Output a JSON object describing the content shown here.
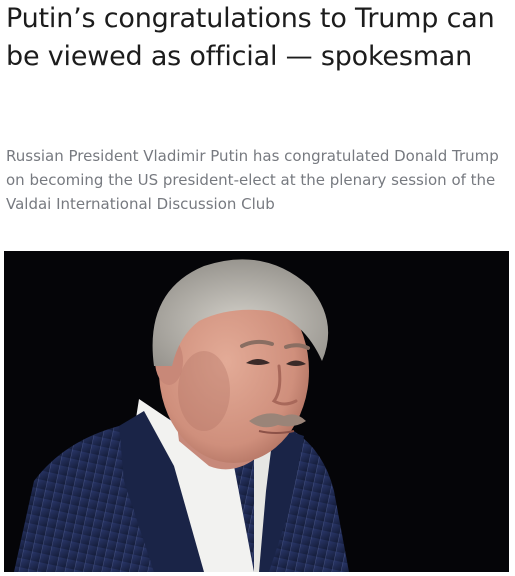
{
  "article": {
    "headline": "Putin’s congratulations to Trump can be viewed as official — spokesman",
    "lead": "Russian President Vladimir Putin has congratulated Donald Trump on becoming the US president-elect at the plenary session of the Valdai International Discussion Club"
  },
  "photo": {
    "background_color": "#050508",
    "suit_color": "#1e2a4f",
    "shirt_color": "#f2f2f0",
    "skin_color": "#d59a86",
    "hair_color": "#bdbab3"
  }
}
